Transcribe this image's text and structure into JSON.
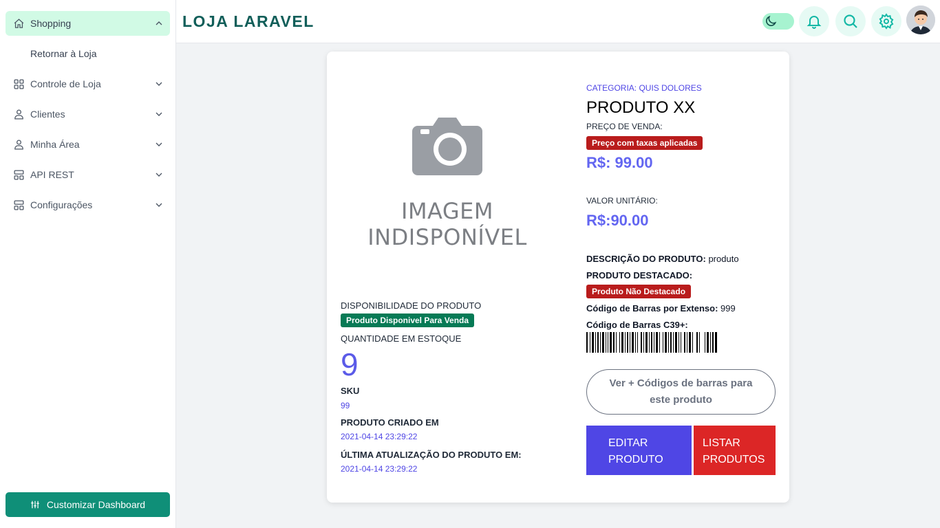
{
  "sidebar": {
    "items": [
      {
        "label": "Shopping",
        "icon": "home-icon"
      },
      {
        "label": "Controle de Loja",
        "icon": "grid-icon"
      },
      {
        "label": "Clientes",
        "icon": "user-icon"
      },
      {
        "label": "Minha Área",
        "icon": "user-icon"
      },
      {
        "label": "API REST",
        "icon": "layout-icon"
      },
      {
        "label": "Configurações",
        "icon": "layout-icon"
      }
    ],
    "sub_item": "Retornar à Loja",
    "customize_label": "Customizar Dashboard"
  },
  "header": {
    "brand": "LOJA LARAVEL",
    "icons": [
      "moon-icon",
      "bell-icon",
      "search-icon",
      "gear-icon",
      "avatar"
    ]
  },
  "product": {
    "image_text_line1": "IMAGEM",
    "image_text_line2": "INDISPONÍVEL",
    "availability_label": "DISPONIBILIDADE DO PRODUTO",
    "availability_badge": "Produto Disponivel Para Venda",
    "stock_label": "QUANTIDADE EM ESTOQUE",
    "stock_value": "9",
    "sku_label": "SKU",
    "sku_value": "99",
    "created_label": "PRODUTO CRIADO EM",
    "created_value": "2021-04-14 23:29:22",
    "updated_label": "ÚLTIMA ATUALIZAÇÃO DO PRODUTO EM:",
    "updated_value": "2021-04-14 23:29:22",
    "category": "CATEGORIA: QUIS DOLORES",
    "name": "PRODUTO XX",
    "sale_price_label": "PREÇO DE VENDA:",
    "tax_badge": "Preço com taxas aplicadas",
    "sale_price": "R$: 99.00",
    "unit_value_label": "VALOR UNITÁRIO:",
    "unit_value": "R$:90.00",
    "description_label": "DESCRIÇÃO DO PRODUTO:",
    "description_value": "produto",
    "featured_label": "PRODUTO DESTACADO:",
    "featured_badge": "Produto Não Destacado",
    "barcode_text_label": "Código de Barras por Extenso:",
    "barcode_text_value": "999",
    "barcode_c39_label": "Código de Barras C39+:",
    "more_barcodes_line1": "Ver + Códigos de barras para",
    "more_barcodes_line2": "este produto",
    "edit_line1": "EDITAR",
    "edit_line2": "PRODUTO",
    "list_line1": "LISTAR",
    "list_line2": "PRODUTOS"
  },
  "colors": {
    "accent": "#0f8f78",
    "brand": "#115e59",
    "price": "#6366f1",
    "edit": "#4f46e5",
    "list": "#dc2626",
    "badge_green": "#067a55",
    "badge_red": "#b91c1c"
  }
}
